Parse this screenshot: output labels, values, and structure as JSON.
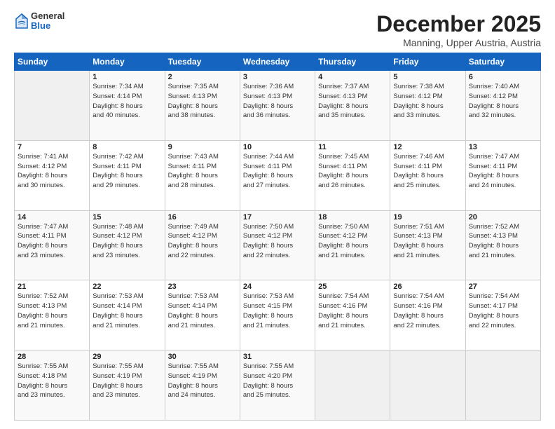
{
  "logo": {
    "general": "General",
    "blue": "Blue"
  },
  "title": "December 2025",
  "subtitle": "Manning, Upper Austria, Austria",
  "days_header": [
    "Sunday",
    "Monday",
    "Tuesday",
    "Wednesday",
    "Thursday",
    "Friday",
    "Saturday"
  ],
  "weeks": [
    [
      {
        "num": "",
        "info": ""
      },
      {
        "num": "1",
        "info": "Sunrise: 7:34 AM\nSunset: 4:14 PM\nDaylight: 8 hours\nand 40 minutes."
      },
      {
        "num": "2",
        "info": "Sunrise: 7:35 AM\nSunset: 4:13 PM\nDaylight: 8 hours\nand 38 minutes."
      },
      {
        "num": "3",
        "info": "Sunrise: 7:36 AM\nSunset: 4:13 PM\nDaylight: 8 hours\nand 36 minutes."
      },
      {
        "num": "4",
        "info": "Sunrise: 7:37 AM\nSunset: 4:13 PM\nDaylight: 8 hours\nand 35 minutes."
      },
      {
        "num": "5",
        "info": "Sunrise: 7:38 AM\nSunset: 4:12 PM\nDaylight: 8 hours\nand 33 minutes."
      },
      {
        "num": "6",
        "info": "Sunrise: 7:40 AM\nSunset: 4:12 PM\nDaylight: 8 hours\nand 32 minutes."
      }
    ],
    [
      {
        "num": "7",
        "info": "Sunrise: 7:41 AM\nSunset: 4:12 PM\nDaylight: 8 hours\nand 30 minutes."
      },
      {
        "num": "8",
        "info": "Sunrise: 7:42 AM\nSunset: 4:11 PM\nDaylight: 8 hours\nand 29 minutes."
      },
      {
        "num": "9",
        "info": "Sunrise: 7:43 AM\nSunset: 4:11 PM\nDaylight: 8 hours\nand 28 minutes."
      },
      {
        "num": "10",
        "info": "Sunrise: 7:44 AM\nSunset: 4:11 PM\nDaylight: 8 hours\nand 27 minutes."
      },
      {
        "num": "11",
        "info": "Sunrise: 7:45 AM\nSunset: 4:11 PM\nDaylight: 8 hours\nand 26 minutes."
      },
      {
        "num": "12",
        "info": "Sunrise: 7:46 AM\nSunset: 4:11 PM\nDaylight: 8 hours\nand 25 minutes."
      },
      {
        "num": "13",
        "info": "Sunrise: 7:47 AM\nSunset: 4:11 PM\nDaylight: 8 hours\nand 24 minutes."
      }
    ],
    [
      {
        "num": "14",
        "info": "Sunrise: 7:47 AM\nSunset: 4:11 PM\nDaylight: 8 hours\nand 23 minutes."
      },
      {
        "num": "15",
        "info": "Sunrise: 7:48 AM\nSunset: 4:12 PM\nDaylight: 8 hours\nand 23 minutes."
      },
      {
        "num": "16",
        "info": "Sunrise: 7:49 AM\nSunset: 4:12 PM\nDaylight: 8 hours\nand 22 minutes."
      },
      {
        "num": "17",
        "info": "Sunrise: 7:50 AM\nSunset: 4:12 PM\nDaylight: 8 hours\nand 22 minutes."
      },
      {
        "num": "18",
        "info": "Sunrise: 7:50 AM\nSunset: 4:12 PM\nDaylight: 8 hours\nand 21 minutes."
      },
      {
        "num": "19",
        "info": "Sunrise: 7:51 AM\nSunset: 4:13 PM\nDaylight: 8 hours\nand 21 minutes."
      },
      {
        "num": "20",
        "info": "Sunrise: 7:52 AM\nSunset: 4:13 PM\nDaylight: 8 hours\nand 21 minutes."
      }
    ],
    [
      {
        "num": "21",
        "info": "Sunrise: 7:52 AM\nSunset: 4:13 PM\nDaylight: 8 hours\nand 21 minutes."
      },
      {
        "num": "22",
        "info": "Sunrise: 7:53 AM\nSunset: 4:14 PM\nDaylight: 8 hours\nand 21 minutes."
      },
      {
        "num": "23",
        "info": "Sunrise: 7:53 AM\nSunset: 4:14 PM\nDaylight: 8 hours\nand 21 minutes."
      },
      {
        "num": "24",
        "info": "Sunrise: 7:53 AM\nSunset: 4:15 PM\nDaylight: 8 hours\nand 21 minutes."
      },
      {
        "num": "25",
        "info": "Sunrise: 7:54 AM\nSunset: 4:16 PM\nDaylight: 8 hours\nand 21 minutes."
      },
      {
        "num": "26",
        "info": "Sunrise: 7:54 AM\nSunset: 4:16 PM\nDaylight: 8 hours\nand 22 minutes."
      },
      {
        "num": "27",
        "info": "Sunrise: 7:54 AM\nSunset: 4:17 PM\nDaylight: 8 hours\nand 22 minutes."
      }
    ],
    [
      {
        "num": "28",
        "info": "Sunrise: 7:55 AM\nSunset: 4:18 PM\nDaylight: 8 hours\nand 23 minutes."
      },
      {
        "num": "29",
        "info": "Sunrise: 7:55 AM\nSunset: 4:19 PM\nDaylight: 8 hours\nand 23 minutes."
      },
      {
        "num": "30",
        "info": "Sunrise: 7:55 AM\nSunset: 4:19 PM\nDaylight: 8 hours\nand 24 minutes."
      },
      {
        "num": "31",
        "info": "Sunrise: 7:55 AM\nSunset: 4:20 PM\nDaylight: 8 hours\nand 25 minutes."
      },
      {
        "num": "",
        "info": ""
      },
      {
        "num": "",
        "info": ""
      },
      {
        "num": "",
        "info": ""
      }
    ]
  ]
}
